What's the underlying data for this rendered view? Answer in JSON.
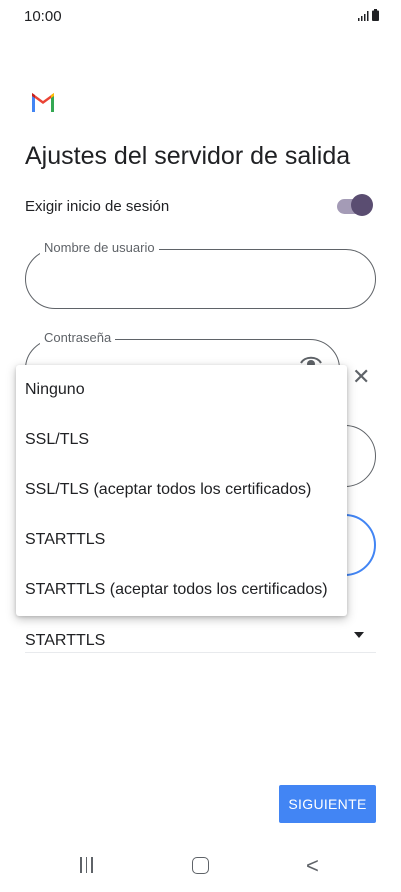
{
  "status_bar": {
    "time": "10:00"
  },
  "page": {
    "title": "Ajustes del servidor de salida"
  },
  "signin_toggle": {
    "label": "Exigir inicio de sesión",
    "on": true
  },
  "fields": {
    "username_label": "Nombre de usuario",
    "password_label": "Contraseña"
  },
  "security": {
    "selected": "STARTTLS"
  },
  "menu": {
    "options": [
      "Ninguno",
      "SSL/TLS",
      "SSL/TLS (aceptar todos los certificados)",
      "STARTTLS",
      "STARTTLS (aceptar todos los certificados)"
    ]
  },
  "next_button": {
    "label": "SIGUIENTE"
  },
  "colors": {
    "accent": "#4285f4",
    "toggle_thumb": "#5a4d71",
    "toggle_track": "#a49bb6"
  },
  "icons": [
    "gmail-logo",
    "signal-icon",
    "battery-icon",
    "eye-icon",
    "close-icon",
    "dropdown-arrow-icon",
    "recents-icon",
    "home-icon",
    "back-icon"
  ]
}
